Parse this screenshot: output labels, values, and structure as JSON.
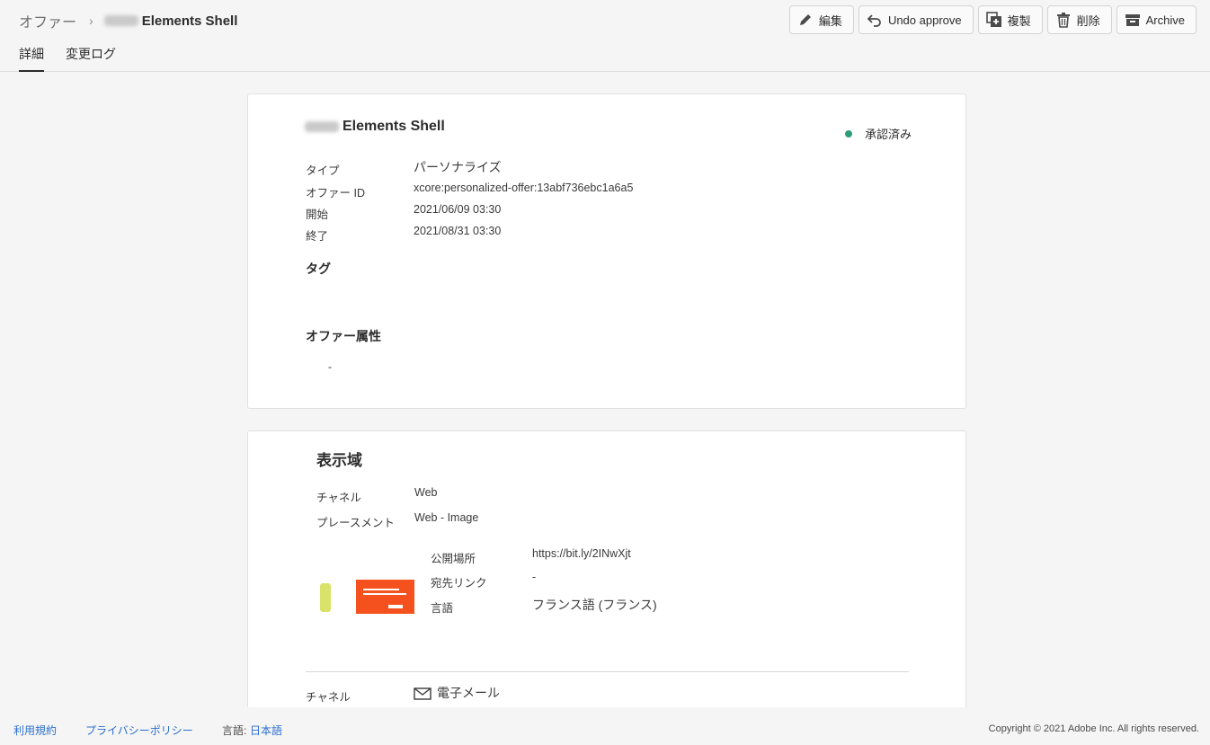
{
  "breadcrumb": {
    "root": "オファー",
    "current": "Elements Shell"
  },
  "tabs": [
    {
      "label": "詳細"
    },
    {
      "label": "変更ログ"
    }
  ],
  "toolbar": {
    "edit": "編集",
    "undo_approve": "Undo approve",
    "duplicate": "複製",
    "delete": "削除",
    "archive": "Archive"
  },
  "offer": {
    "title": "Elements Shell",
    "status": "承認済み",
    "status_color": "#2d9d78",
    "fields": [
      {
        "label": "タイプ",
        "value": "パーソナライズ"
      },
      {
        "label": "オファー ID",
        "value": "xcore:personalized-offer:13abf736ebc1a6a5"
      },
      {
        "label": "開始",
        "value": "2021/06/09 03:30"
      },
      {
        "label": "終了",
        "value": "2021/08/31 03:30"
      }
    ],
    "tags_heading": "タグ",
    "attributes_heading": "オファー属性",
    "attributes_value": "-"
  },
  "representations": {
    "title": "表示域",
    "channel_label": "チャネル",
    "channel_value": "Web",
    "placement_label": "プレースメント",
    "placement_value": "Web - Image",
    "content": [
      {
        "label": "公開場所",
        "value": "https://bit.ly/2INwXjt"
      },
      {
        "label": "宛先リンク",
        "value": "-"
      },
      {
        "label": "言語",
        "value": "フランス語 (フランス)"
      }
    ],
    "second_channel_label": "チャネル",
    "second_channel_value": "電子メール"
  },
  "footer": {
    "terms": "利用規約",
    "privacy": "プライバシーポリシー",
    "language_label": "言語:",
    "language_value": "日本語",
    "copyright": "Copyright ©  2021 Adobe Inc.  All rights reserved."
  }
}
